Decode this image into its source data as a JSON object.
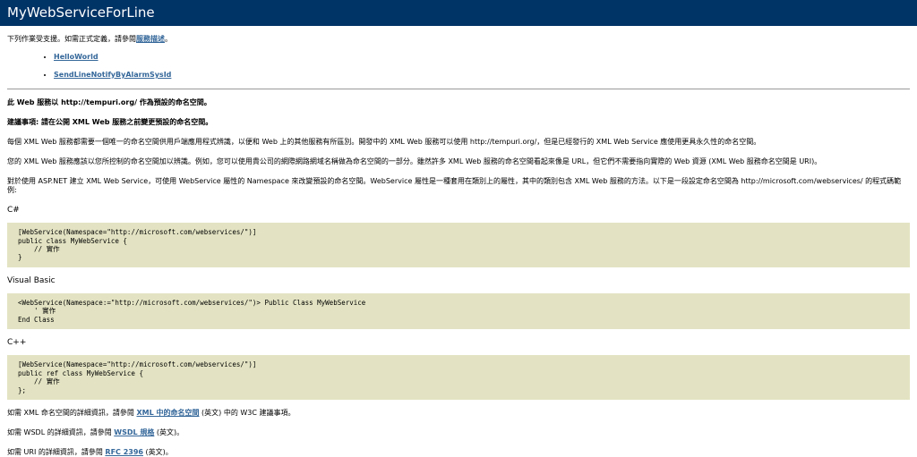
{
  "header": {
    "title": "MyWebServiceForLine"
  },
  "intro": {
    "text": "下列作業受支援。如需正式定義，請參閱",
    "link": "服務描述",
    "end": "。"
  },
  "operations": [
    {
      "label": "HelloWorld"
    },
    {
      "label": "SendLineNotifyByAlarmSysId"
    }
  ],
  "namespace": {
    "p1_prefix": "此 Web 服務以",
    "p1_ns": "http://tempuri.org/",
    "p1_suffix": "作為預設的命名空間。",
    "p2": "建議事項: 請在公開 XML Web 服務之前變更預設的命名空間。",
    "p3": "每個 XML Web 服務都需要一個唯一的命名空間供用戶端應用程式辨識，以便和 Web 上的其他服務有所區別。開發中的 XML Web 服務可以使用 http://tempuri.org/，但是已經發行的 XML Web Service 應使用更具永久性的命名空間。",
    "p4": "您的 XML Web 服務應該以您所控制的命名空間加以辨識。例如，您可以使用貴公司的網際網路網域名稱做為命名空間的一部分。雖然許多 XML Web 服務的命名空間看起來像是 URL，但它們不需要指向實際的 Web 資源 (XML Web 服務命名空間是 URI)。",
    "p5": "對於使用 ASP.NET 建立 XML Web Service，可使用 WebService 屬性的 Namespace 來改變預設的命名空間。WebService 屬性是一種套用在類別上的屬性，其中的類別包含 XML Web 服務的方法。以下是一段設定命名空間為 http://microsoft.com/webservices/ 的程式碼範例:"
  },
  "examples": [
    {
      "lang": "C#",
      "code": "[WebService(Namespace=\"http://microsoft.com/webservices/\")]\npublic class MyWebService {\n    // 實作\n}"
    },
    {
      "lang": "Visual Basic",
      "code": "<WebService(Namespace:=\"http://microsoft.com/webservices/\")> Public Class MyWebService\n    ' 實作\nEnd Class"
    },
    {
      "lang": "C++",
      "code": "[WebService(Namespace=\"http://microsoft.com/webservices/\")]\npublic ref class MyWebService {\n    // 實作\n};"
    }
  ],
  "refs": {
    "xml_prefix": "如需 XML 命名空間的詳細資訊，請參閱",
    "xml_link": "XML 中的命名空間",
    "xml_suffix": "(英文) 中的 W3C 建議事項。",
    "wsdl_prefix": "如需 WSDL 的詳細資訊，請參閱",
    "wsdl_link": "WSDL 規格",
    "wsdl_suffix": "(英文)。",
    "uri_prefix": "如需 URI 的詳細資訊，請參閱",
    "uri_link": "RFC 2396",
    "uri_suffix": "(英文)。"
  }
}
